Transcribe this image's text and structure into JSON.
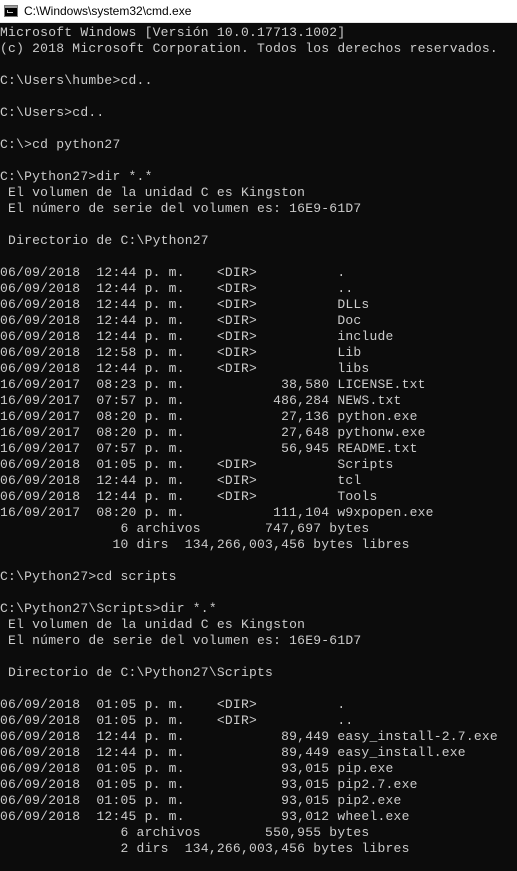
{
  "window": {
    "title": "C:\\Windows\\system32\\cmd.exe",
    "icon": "cmd-icon"
  },
  "console": {
    "lines": [
      "Microsoft Windows [Versión 10.0.17713.1002]",
      "(c) 2018 Microsoft Corporation. Todos los derechos reservados.",
      "",
      "C:\\Users\\humbe>cd..",
      "",
      "C:\\Users>cd..",
      "",
      "C:\\>cd python27",
      "",
      "C:\\Python27>dir *.*",
      " El volumen de la unidad C es Kingston",
      " El número de serie del volumen es: 16E9-61D7",
      "",
      " Directorio de C:\\Python27",
      "",
      "06/09/2018  12:44 p. m.    <DIR>          .",
      "06/09/2018  12:44 p. m.    <DIR>          ..",
      "06/09/2018  12:44 p. m.    <DIR>          DLLs",
      "06/09/2018  12:44 p. m.    <DIR>          Doc",
      "06/09/2018  12:44 p. m.    <DIR>          include",
      "06/09/2018  12:58 p. m.    <DIR>          Lib",
      "06/09/2018  12:44 p. m.    <DIR>          libs",
      "16/09/2017  08:23 p. m.            38,580 LICENSE.txt",
      "16/09/2017  07:57 p. m.           486,284 NEWS.txt",
      "16/09/2017  08:20 p. m.            27,136 python.exe",
      "16/09/2017  08:20 p. m.            27,648 pythonw.exe",
      "16/09/2017  07:57 p. m.            56,945 README.txt",
      "06/09/2018  01:05 p. m.    <DIR>          Scripts",
      "06/09/2018  12:44 p. m.    <DIR>          tcl",
      "06/09/2018  12:44 p. m.    <DIR>          Tools",
      "16/09/2017  08:20 p. m.           111,104 w9xpopen.exe",
      "               6 archivos        747,697 bytes",
      "              10 dirs  134,266,003,456 bytes libres",
      "",
      "C:\\Python27>cd scripts",
      "",
      "C:\\Python27\\Scripts>dir *.*",
      " El volumen de la unidad C es Kingston",
      " El número de serie del volumen es: 16E9-61D7",
      "",
      " Directorio de C:\\Python27\\Scripts",
      "",
      "06/09/2018  01:05 p. m.    <DIR>          .",
      "06/09/2018  01:05 p. m.    <DIR>          ..",
      "06/09/2018  12:44 p. m.            89,449 easy_install-2.7.exe",
      "06/09/2018  12:44 p. m.            89,449 easy_install.exe",
      "06/09/2018  01:05 p. m.            93,015 pip.exe",
      "06/09/2018  01:05 p. m.            93,015 pip2.7.exe",
      "06/09/2018  01:05 p. m.            93,015 pip2.exe",
      "06/09/2018  12:45 p. m.            93,012 wheel.exe",
      "               6 archivos        550,955 bytes",
      "               2 dirs  134,266,003,456 bytes libres"
    ]
  }
}
